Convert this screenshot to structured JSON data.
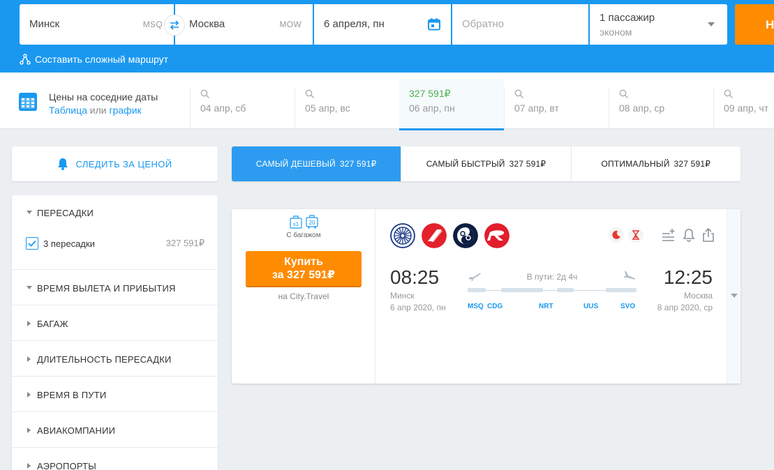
{
  "search": {
    "from_city": "Минск",
    "from_code": "MSQ",
    "to_city": "Москва",
    "to_code": "MOW",
    "date": "6 апреля, пн",
    "return_placeholder": "Обратно",
    "passengers": "1 пассажир",
    "cabin": "эконом",
    "find_button": "Н",
    "complex_route": "Составить сложный маршрут"
  },
  "nearby": {
    "title": "Цены на соседние даты",
    "table": "Таблица",
    "or": "или",
    "chart": "график",
    "dates": [
      {
        "price": "",
        "date": "04 апр, сб"
      },
      {
        "price": "",
        "date": "05 апр, вс"
      },
      {
        "price": "327 591₽",
        "date": "06 апр, пн"
      },
      {
        "price": "",
        "date": "07 апр, вт"
      },
      {
        "price": "",
        "date": "08 апр, ср"
      },
      {
        "price": "",
        "date": "09 апр, чт"
      }
    ]
  },
  "sidebar": {
    "watch_price": "СЛЕДИТЬ ЗА ЦЕНОЙ",
    "filters": [
      {
        "title": "ПЕРЕСАДКИ",
        "expanded": true
      },
      {
        "title": "ВРЕМЯ ВЫЛЕТА И ПРИБЫТИЯ",
        "expanded": true
      },
      {
        "title": "БАГАЖ"
      },
      {
        "title": "ДЛИТЕЛЬНОСТЬ ПЕРЕСАДКИ"
      },
      {
        "title": "ВРЕМЯ В ПУТИ"
      },
      {
        "title": "АВИАКОМПАНИИ"
      },
      {
        "title": "АЭРОПОРТЫ"
      }
    ],
    "stops_option": {
      "label": "3 пересадки",
      "price": "327 591₽",
      "checked": true
    }
  },
  "sort_tabs": [
    {
      "label": "САМЫЙ ДЕШЕВЫЙ",
      "price": "327 591₽",
      "active": true
    },
    {
      "label": "САМЫЙ БЫСТРЫЙ",
      "price": "327 591₽"
    },
    {
      "label": "ОПТИМАЛЬНЫЙ",
      "price": "327 591₽"
    }
  ],
  "ticket": {
    "bag_x": "x1",
    "bag_kg": "20",
    "baggage_label": "С багажом",
    "buy_line1": "Купить",
    "buy_line2": "за 327 591₽",
    "agency": "на City.Travel",
    "departure_time": "08:25",
    "departure_city": "Минск",
    "departure_date": "6 апр 2020, пн",
    "arrival_time": "12:25",
    "arrival_city": "Москва",
    "arrival_date": "8 апр 2020, ср",
    "duration": "В пути: 2д 4ч",
    "airports": [
      "MSQ",
      "CDG",
      "NRT",
      "UUS",
      "SVO"
    ],
    "colors": {
      "accent": "#1a98f0",
      "buy": "#ff8b00"
    }
  }
}
